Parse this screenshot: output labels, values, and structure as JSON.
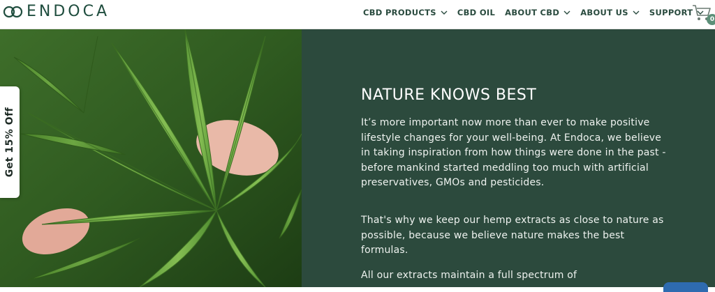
{
  "brand": {
    "name": "ENDOCA",
    "color": "#1f4d3e"
  },
  "nav": {
    "items": [
      {
        "label": "CBD PRODUCTS",
        "has_dropdown": true
      },
      {
        "label": "CBD OIL",
        "has_dropdown": false
      },
      {
        "label": "ABOUT CBD",
        "has_dropdown": true
      },
      {
        "label": "ABOUT US",
        "has_dropdown": true
      },
      {
        "label": "SUPPORT",
        "has_dropdown": true
      }
    ]
  },
  "cart": {
    "count": "0",
    "icon": "shopping-cart-icon"
  },
  "discount_tab": {
    "label": "Get 15% Off"
  },
  "hero": {
    "title": "NATURE KNOWS BEST",
    "paragraphs": [
      "It’s more important now more than ever to make positive lifestyle changes for your well-being. At Endoca, we believe in taking inspiration from how things were done in the past - before mankind started meddling too much with artificial preservatives, GMOs and pesticides.",
      "That's why we keep our hemp extracts as close to nature as possible, because we believe nature makes the best formulas.",
      "All our extracts maintain a full spectrum of"
    ],
    "panel_color": "#2c4a3d",
    "image_subject": "hemp-plant-leaves-image"
  }
}
